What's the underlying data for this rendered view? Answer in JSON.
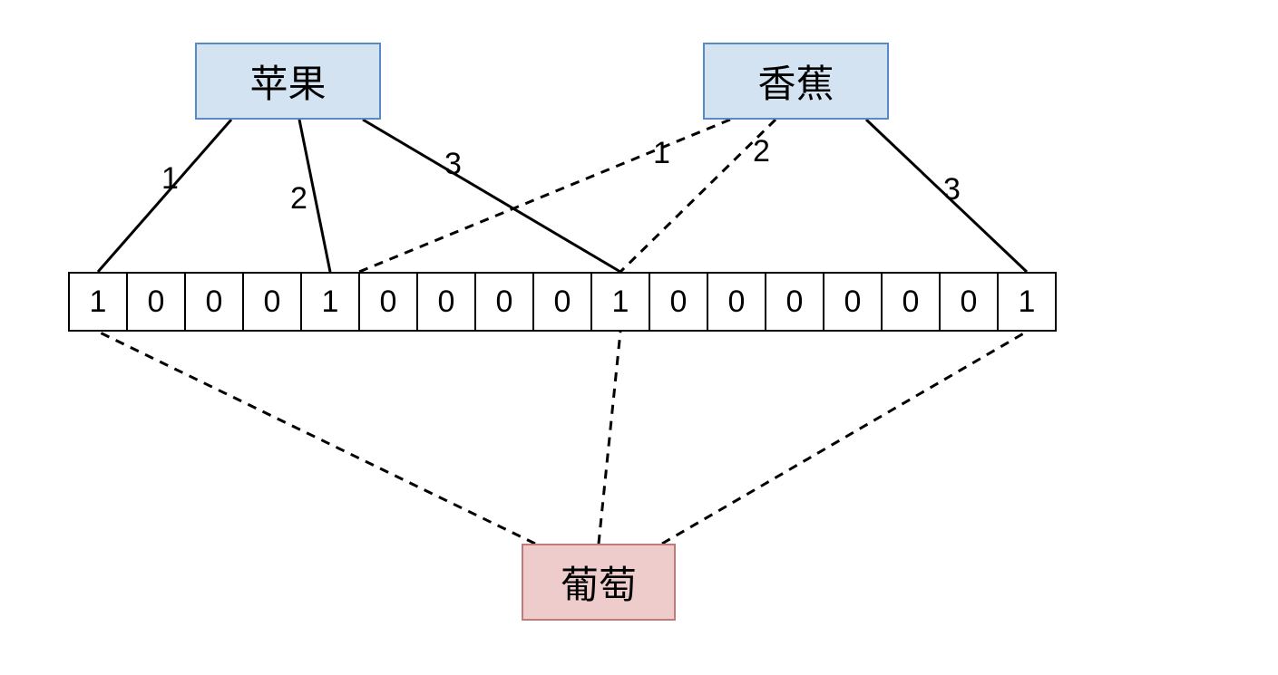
{
  "nodes": {
    "apple": {
      "label": "苹果"
    },
    "banana": {
      "label": "香蕉"
    },
    "grape": {
      "label": "葡萄"
    }
  },
  "bits": [
    "1",
    "0",
    "0",
    "0",
    "1",
    "0",
    "0",
    "0",
    "0",
    "1",
    "0",
    "0",
    "0",
    "0",
    "0",
    "0",
    "1"
  ],
  "edge_labels": {
    "apple_1": "1",
    "apple_2": "2",
    "apple_3": "3",
    "banana_1": "1",
    "banana_2": "2",
    "banana_3": "3"
  },
  "chart_data": {
    "type": "table",
    "title": "Bloom filter bit array with hash mappings",
    "bit_array": [
      1,
      0,
      0,
      0,
      1,
      0,
      0,
      0,
      0,
      1,
      0,
      0,
      0,
      0,
      0,
      0,
      1
    ],
    "series": [
      {
        "name": "苹果",
        "style": "solid",
        "role": "inserted",
        "hash_targets": [
          0,
          4,
          9
        ],
        "hash_labels": [
          1,
          2,
          3
        ]
      },
      {
        "name": "香蕉",
        "style": "dashed",
        "role": "inserted",
        "hash_targets": [
          4,
          9,
          16
        ],
        "hash_labels": [
          1,
          2,
          3
        ]
      },
      {
        "name": "葡萄",
        "style": "dashed",
        "role": "query",
        "hash_targets": [
          0,
          9,
          16
        ]
      }
    ]
  }
}
